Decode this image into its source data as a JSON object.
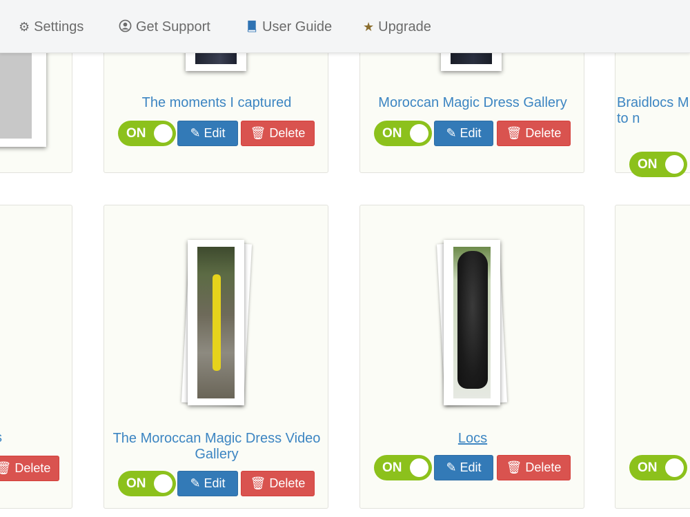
{
  "nav": {
    "settings": "Settings",
    "support": "Get Support",
    "guide": "User Guide",
    "upgrade": "Upgrade"
  },
  "buttons": {
    "on": "ON",
    "edit": "Edit",
    "delete": "Delete"
  },
  "galleries": [
    {
      "title": "The moments I captured",
      "enabled": true
    },
    {
      "title": "Moroccan Magic Dress Gallery",
      "enabled": true
    },
    {
      "title": "Braidlocs M hair to n",
      "enabled": true
    },
    {
      "title": "s",
      "enabled": true
    },
    {
      "title": "The Moroccan Magic Dress Video Gallery",
      "enabled": true
    },
    {
      "title": "Locs",
      "enabled": true
    },
    {
      "title": "",
      "enabled": true
    }
  ],
  "colors": {
    "toggle_on": "#8cc11c",
    "edit": "#337ab7",
    "delete": "#d9534f",
    "title_link": "#3c85c2"
  }
}
